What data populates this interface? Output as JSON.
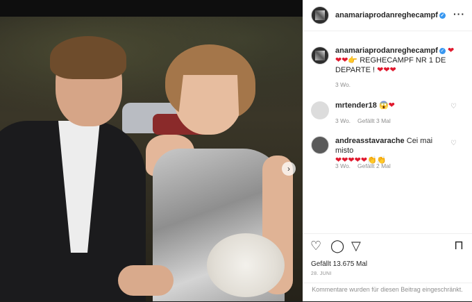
{
  "post": {
    "username": "anamariaprodanreghecampf",
    "caption_emojis_line1": "❤",
    "caption_emojis_line2": "❤❤👉",
    "caption_text": "REGHECAMPF NR 1 DE DEPARTE !",
    "caption_emojis_end": "❤❤❤",
    "caption_time": "3 Wo.",
    "likes": "Gefällt 13.675 Mal",
    "date": "28. JUNI",
    "comments_disabled": "Kommentare wurden für diesen Beitrag eingeschränkt."
  },
  "comments": [
    {
      "username": "mrtender18",
      "text": "😱❤",
      "time": "3 Wo.",
      "likes": "Gefällt 3 Mal"
    },
    {
      "username": "andreasstavarache",
      "text": "Cei mai misto",
      "emojis": "❤❤❤❤❤👏👏",
      "time": "3 Wo.",
      "likes": "Gefällt 2 Mal"
    }
  ],
  "icons": {
    "more": "more-options-icon",
    "like": "heart-icon",
    "comment": "comment-icon",
    "share": "share-icon",
    "save": "bookmark-icon",
    "next": "chevron-right-icon"
  },
  "colors": {
    "accent": "#3897f0",
    "heart": "#e0182d",
    "text": "#262626",
    "muted": "#8e8e8e"
  }
}
